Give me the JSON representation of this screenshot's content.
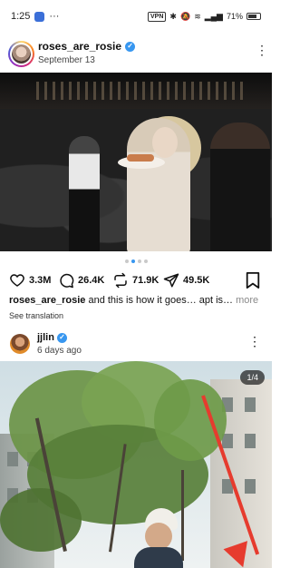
{
  "status_bar": {
    "time": "1:25",
    "battery_text": "71",
    "battery_unit": "%",
    "vpn_label": "VPN",
    "battery_level": 0.71
  },
  "post1": {
    "username": "roses_are_rosie",
    "date": "September 13",
    "carousel": {
      "count": 4,
      "active_index": 1
    },
    "actions": {
      "likes": "3.3M",
      "comments": "26.4K",
      "reposts": "71.9K",
      "shares": "49.5K"
    },
    "caption": {
      "username": "roses_are_rosie",
      "text": " and this is how it goes… apt is…",
      "more": " more"
    },
    "see_translation": "See translation"
  },
  "post2": {
    "username": "jjlin",
    "time_ago": "6 days ago",
    "counter": "1/4"
  },
  "colors": {
    "verified": "#3897f0",
    "annotation_arrow": "#e63b2e"
  }
}
